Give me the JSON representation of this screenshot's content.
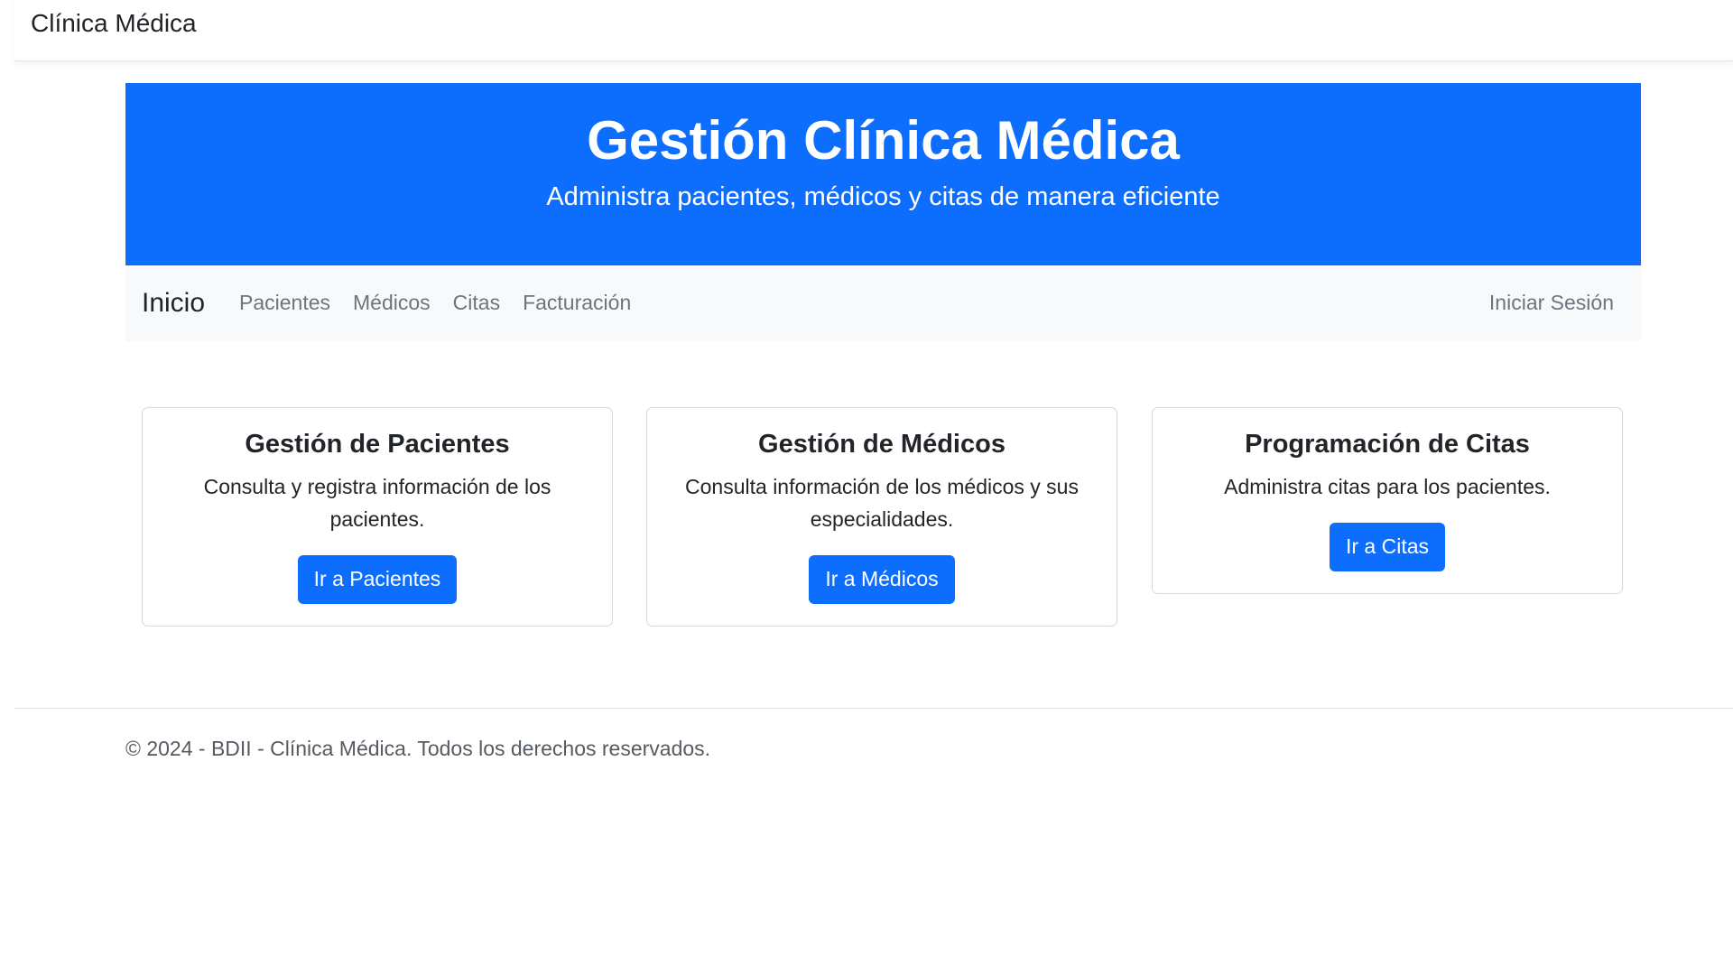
{
  "topbar": {
    "brand": "Clínica Médica"
  },
  "hero": {
    "title": "Gestión Clínica Médica",
    "subtitle": "Administra pacientes, médicos y citas de manera eficiente",
    "background_color": "#0d6efd"
  },
  "navbar": {
    "home": "Inicio",
    "links": [
      "Pacientes",
      "Médicos",
      "Citas",
      "Facturación"
    ],
    "login": "Iniciar Sesión"
  },
  "cards": [
    {
      "title": "Gestión de Pacientes",
      "text": "Consulta y registra información de los pacientes.",
      "button": "Ir a Pacientes"
    },
    {
      "title": "Gestión de Médicos",
      "text": "Consulta información de los médicos y sus especialidades.",
      "button": "Ir a Médicos"
    },
    {
      "title": "Programación de Citas",
      "text": "Administra citas para los pacientes.",
      "button": "Ir a Citas"
    }
  ],
  "footer": {
    "text": "© 2024 - BDII - Clínica Médica. Todos los derechos reservados."
  },
  "colors": {
    "primary": "#0d6efd",
    "navbar_bg": "#f8f9fa",
    "muted_link": "#6c757d"
  }
}
